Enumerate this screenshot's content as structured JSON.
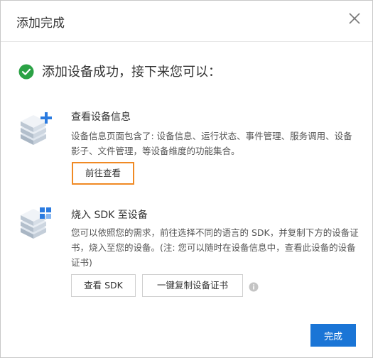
{
  "dialog": {
    "title": "添加完成",
    "close_icon": "close-icon"
  },
  "success": {
    "icon": "check-circle-icon",
    "color": "#2ba245",
    "message": "添加设备成功，接下来您可以："
  },
  "sections": [
    {
      "icon": "server-plus-icon",
      "title": "查看设备信息",
      "desc": "设备信息页面包含了: 设备信息、运行状态、事件管理、服务调用、设备影子、文件管理，等设备维度的功能集合。",
      "button": "前往查看"
    },
    {
      "icon": "server-grid-icon",
      "title": "烧入 SDK 至设备",
      "desc": "您可以依照您的需求，前往选择不同的语言的 SDK，并复制下方的设备证书，烧入至您的设备。(注: 您可以随时在设备信息中，查看此设备的设备证书)",
      "buttons": [
        "查看 SDK",
        "一键复制设备证书"
      ],
      "info_icon": "info-icon"
    }
  ],
  "footer": {
    "done_label": "完成",
    "accent": "#1a75d6"
  }
}
